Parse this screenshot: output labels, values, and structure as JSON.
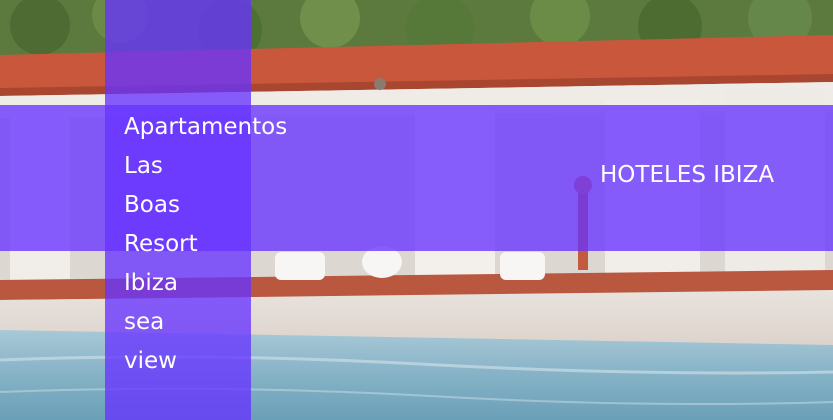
{
  "hotel": {
    "name_lines": [
      "Apartamentos",
      "Las",
      "Boas",
      "Resort",
      "Ibiza",
      "sea",
      "view"
    ]
  },
  "category_link": {
    "label": "HOTELES IBIZA"
  },
  "colors": {
    "overlay": "#6633ff",
    "text": "#ffffff"
  }
}
